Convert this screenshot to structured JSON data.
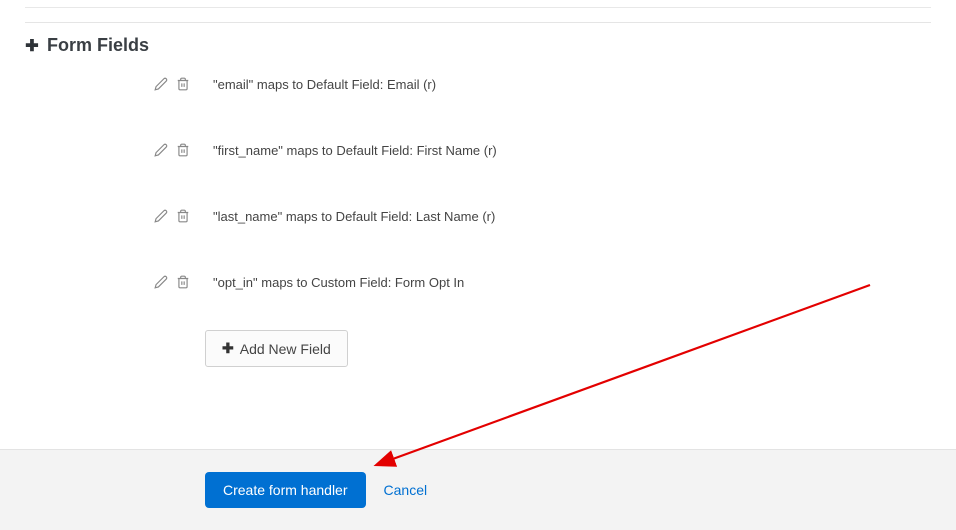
{
  "section": {
    "title": "Form Fields"
  },
  "fields": [
    {
      "text": "\"email\" maps to Default Field: Email (r)"
    },
    {
      "text": "\"first_name\" maps to Default Field: First Name (r)"
    },
    {
      "text": "\"last_name\" maps to Default Field: Last Name (r)"
    },
    {
      "text": "\"opt_in\" maps to Custom Field: Form Opt In"
    }
  ],
  "buttons": {
    "add_field": "Add New Field",
    "primary": "Create form handler",
    "cancel": "Cancel"
  }
}
